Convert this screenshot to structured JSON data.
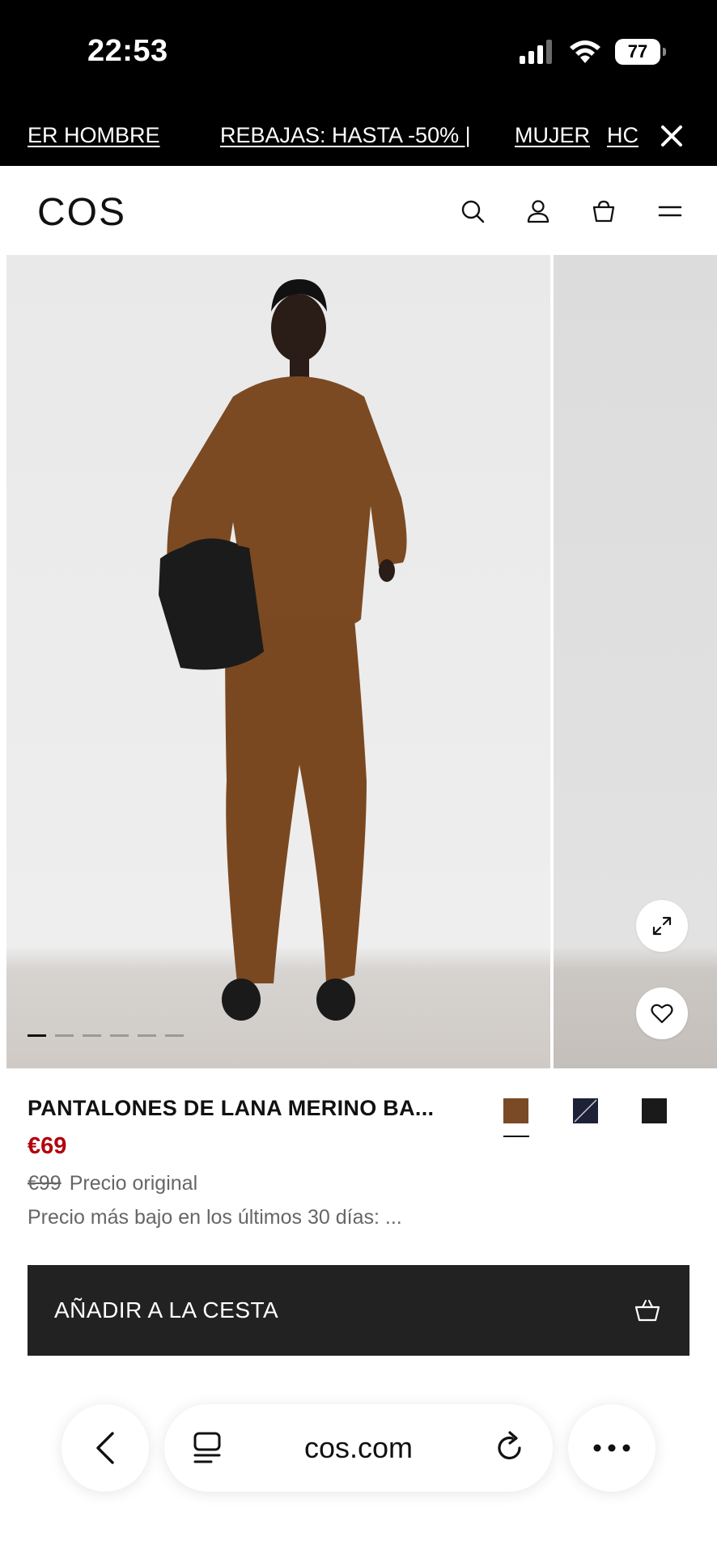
{
  "status_bar": {
    "time": "22:53",
    "battery": "77"
  },
  "promo": {
    "items": [
      "ER HOMBRE",
      "REBAJAS: HASTA -50% |",
      "MUJER",
      "HC"
    ]
  },
  "header": {
    "logo": "COS"
  },
  "gallery": {
    "image_count": 6,
    "active_index": 0
  },
  "product": {
    "title": "PANTALONES DE LANA MERINO BA...",
    "price": "€69",
    "original_price": "€99",
    "original_label": "Precio original",
    "lowest_price_text": "Precio más bajo en los últimos 30 días: ...",
    "swatches": [
      {
        "name": "brown",
        "color": "#7a4a26",
        "selected": true
      },
      {
        "name": "navy-striped",
        "color": "#1e2236",
        "selected": false
      },
      {
        "name": "black",
        "color": "#1a1a1a",
        "selected": false
      }
    ]
  },
  "add_to_basket": {
    "label": "AÑADIR A LA CESTA"
  },
  "safari": {
    "url": "cos.com"
  },
  "colors": {
    "sale_red": "#b3000c",
    "button_dark": "#222222"
  }
}
